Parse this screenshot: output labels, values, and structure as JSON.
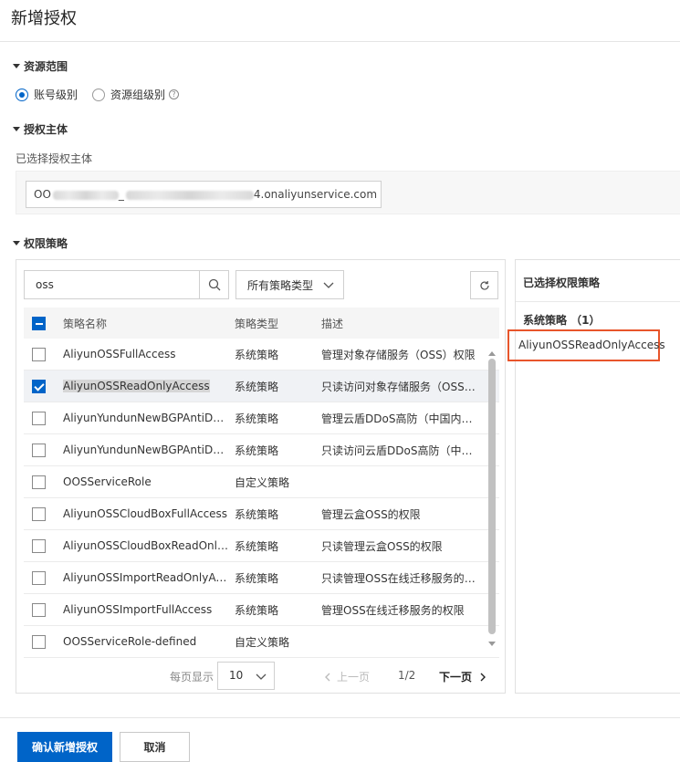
{
  "page": {
    "title": "新增授权"
  },
  "resource_scope": {
    "heading": "资源范围",
    "options": [
      {
        "label": "账号级别",
        "selected": true
      },
      {
        "label": "资源组级别",
        "selected": false
      }
    ]
  },
  "principal": {
    "heading": "授权主体",
    "selected_label": "已选择授权主体",
    "value_prefix": "OO",
    "value_middle": "_",
    "value_suffix": "4.onaliyunservice.com"
  },
  "policies": {
    "heading": "权限策略",
    "search": {
      "value": "oss"
    },
    "type_filter": {
      "value": "所有策略类型"
    },
    "columns": {
      "name": "策略名称",
      "type": "策略类型",
      "desc": "描述"
    },
    "rows": [
      {
        "name": "AliyunOSSFullAccess",
        "type": "系统策略",
        "desc": "管理对象存储服务（OSS）权限",
        "checked": false
      },
      {
        "name": "AliyunOSSReadOnlyAccess",
        "type": "系统策略",
        "desc": "只读访问对象存储服务（OSS）权限",
        "checked": true
      },
      {
        "name": "AliyunYundunNewBGPAntiDDoSFullAccess",
        "type": "系统策略",
        "desc": "管理云盾DDoS高防（中国内地）的权限",
        "checked": false
      },
      {
        "name": "AliyunYundunNewBGPAntiDDoSReadOnlyAccess",
        "type": "系统策略",
        "desc": "只读访问云盾DDoS高防（中国内地）的权限",
        "checked": false
      },
      {
        "name": "OOSServiceRole",
        "type": "自定义策略",
        "desc": "",
        "checked": false
      },
      {
        "name": "AliyunOSSCloudBoxFullAccess",
        "type": "系统策略",
        "desc": "管理云盒OSS的权限",
        "checked": false
      },
      {
        "name": "AliyunOSSCloudBoxReadOnlyAccess",
        "type": "系统策略",
        "desc": "只读管理云盒OSS的权限",
        "checked": false
      },
      {
        "name": "AliyunOSSImportReadOnlyAccess",
        "type": "系统策略",
        "desc": "只读管理OSS在线迁移服务的权限",
        "checked": false
      },
      {
        "name": "AliyunOSSImportFullAccess",
        "type": "系统策略",
        "desc": "管理OSS在线迁移服务的权限",
        "checked": false
      },
      {
        "name": "OOSServiceRole-defined",
        "type": "自定义策略",
        "desc": "",
        "checked": false
      }
    ],
    "pagination": {
      "page_size_label": "每页显示",
      "page_size": "10",
      "prev_label": "上一页",
      "page_indicator": "1/2",
      "next_label": "下一页"
    }
  },
  "selected_panel": {
    "title": "已选择权限策略",
    "group_label": "系统策略 （1）",
    "items": [
      "AliyunOSSReadOnlyAccess"
    ]
  },
  "footer": {
    "confirm_label": "确认新增授权",
    "cancel_label": "取消"
  },
  "colors": {
    "primary": "#0064c8",
    "highlight_border": "#e8552b"
  }
}
